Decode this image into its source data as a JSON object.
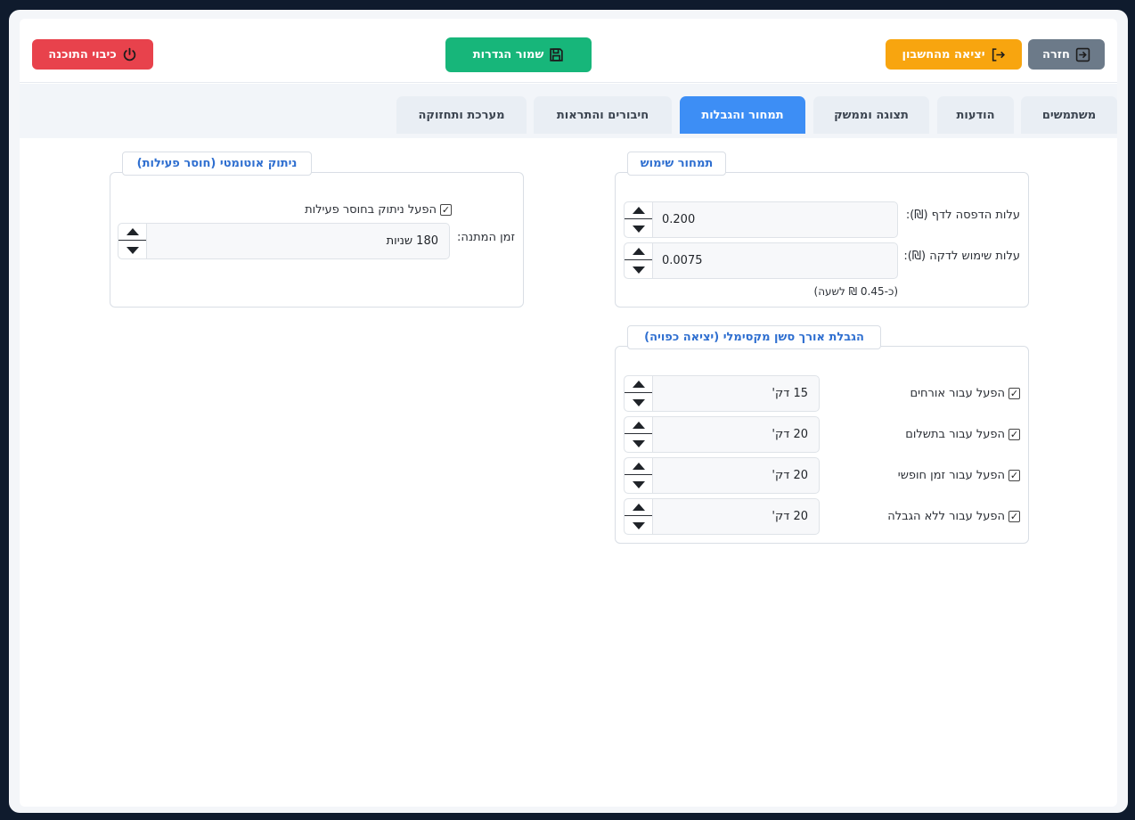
{
  "toolbar": {
    "back_label": "חזרה",
    "exit_label": "יציאה מהחשבון",
    "save_label": "שמור הגדרות",
    "shutdown_label": "כיבוי התוכנה"
  },
  "tabs": [
    {
      "label": "משתמשים"
    },
    {
      "label": "הודעות"
    },
    {
      "label": "תצוגה וממשק"
    },
    {
      "label": "תמחור והגבלות"
    },
    {
      "label": "חיבורים והתראות"
    },
    {
      "label": "מערכת ותחזוקה"
    }
  ],
  "active_tab": "תמחור והגבלות",
  "pricing": {
    "legend": "תמחור שימוש",
    "print_cost_label": "עלות הדפסה לדף (₪):",
    "print_cost_value": "0.200",
    "minute_cost_label": "עלות שימוש לדקה (₪):",
    "minute_cost_value": "0.0075",
    "hourly_note": "(כ-0.45 ₪ לשעה)"
  },
  "session_limit": {
    "legend": "הגבלת אורך סשן מקסימלי (יציאה כפויה)",
    "rows": [
      {
        "label": "הפעל עבור אורחים",
        "checked": true,
        "value": "15 דק'"
      },
      {
        "label": "הפעל עבור בתשלום",
        "checked": true,
        "value": "20 דק'"
      },
      {
        "label": "הפעל עבור זמן חופשי",
        "checked": true,
        "value": "20 דק'"
      },
      {
        "label": "הפעל עבור ללא הגבלה",
        "checked": true,
        "value": "20 דק'"
      }
    ]
  },
  "auto_logout": {
    "legend": "ניתוק אוטומטי (חוסר פעילות)",
    "enable_label": "הפעל ניתוק בחוסר פעילות",
    "enabled": true,
    "wait_label": "זמן המתנה:",
    "wait_value": "180 שניות"
  },
  "colors": {
    "accent": "#3d8ef5",
    "back": "#6c7a89",
    "exit": "#f8a50f",
    "save": "#17b67a",
    "shutdown": "#e8424c",
    "legend_text": "#2f6fd0"
  },
  "icons": {
    "back": "box-arrow-in-icon",
    "exit": "box-arrow-right-icon",
    "save": "floppy-disk-icon",
    "shutdown": "power-icon"
  }
}
